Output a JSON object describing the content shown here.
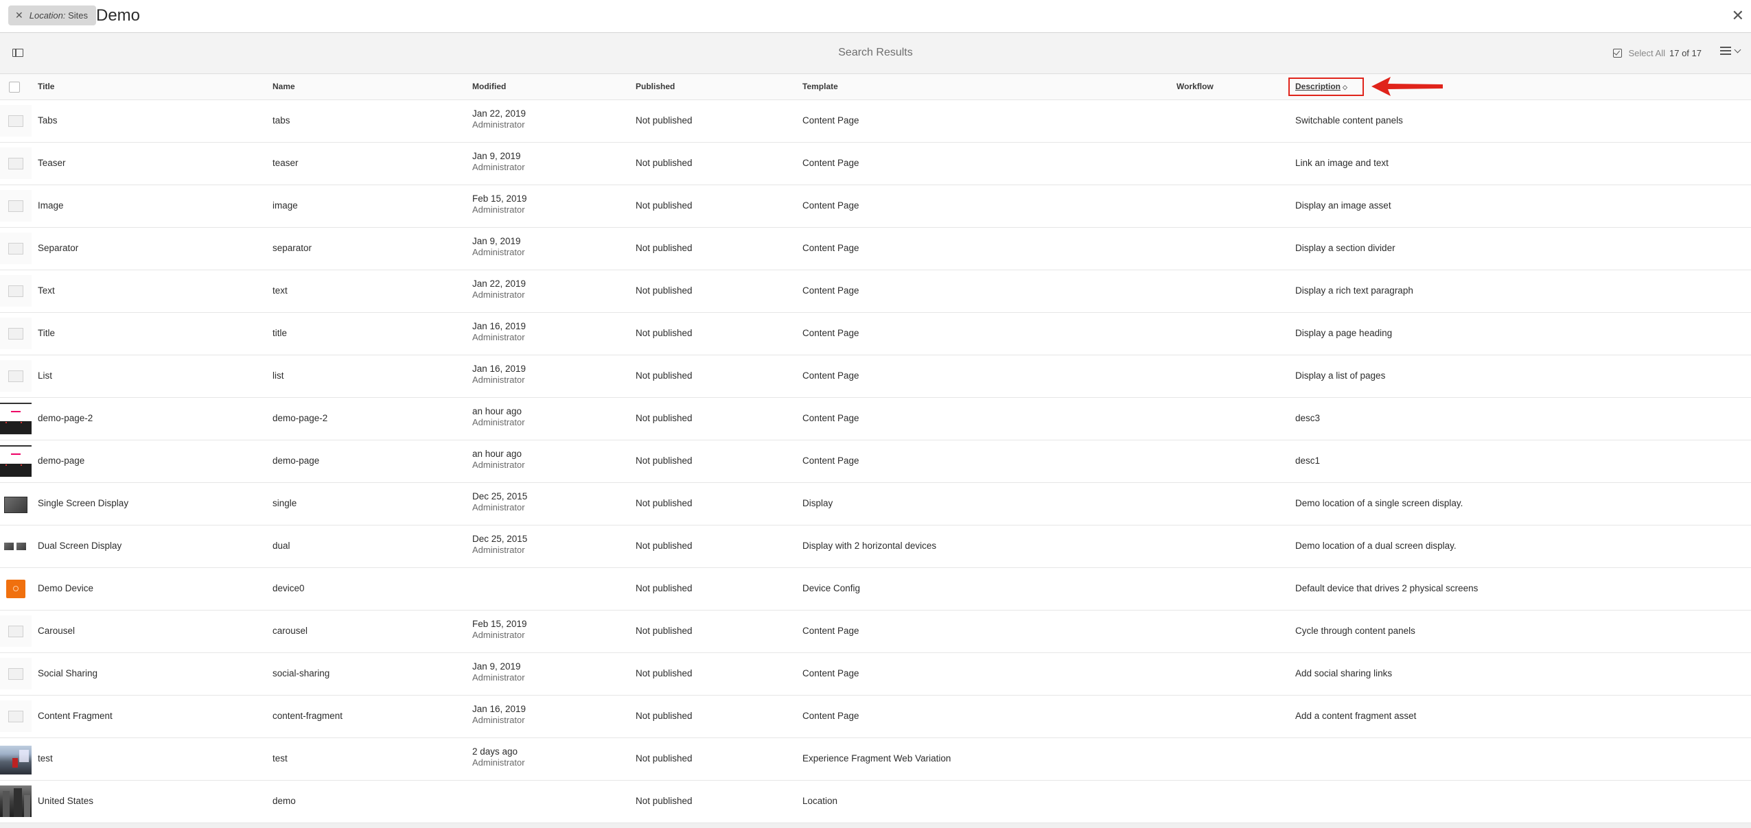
{
  "search": {
    "location_key": "Location:",
    "location_value": "Sites",
    "query": "Demo",
    "remove_icon": "close-icon",
    "close_icon": "close-icon"
  },
  "actionbar": {
    "title": "Search Results",
    "select_all": "Select All",
    "count": "17 of 17"
  },
  "columns": {
    "title": "Title",
    "name": "Name",
    "modified": "Modified",
    "published": "Published",
    "template": "Template",
    "workflow": "Workflow",
    "description": "Description"
  },
  "highlight_color": "#e0241b",
  "rows": [
    {
      "title": "Tabs",
      "name": "tabs",
      "modified": "Jan 22, 2019",
      "by": "Administrator",
      "published": "Not published",
      "template": "Content Page",
      "description": "Switchable content panels",
      "thumb": "component"
    },
    {
      "title": "Teaser",
      "name": "teaser",
      "modified": "Jan 9, 2019",
      "by": "Administrator",
      "published": "Not published",
      "template": "Content Page",
      "description": "Link an image and text",
      "thumb": "component"
    },
    {
      "title": "Image",
      "name": "image",
      "modified": "Feb 15, 2019",
      "by": "Administrator",
      "published": "Not published",
      "template": "Content Page",
      "description": "Display an image asset",
      "thumb": "component"
    },
    {
      "title": "Separator",
      "name": "separator",
      "modified": "Jan 9, 2019",
      "by": "Administrator",
      "published": "Not published",
      "template": "Content Page",
      "description": "Display a section divider",
      "thumb": "component"
    },
    {
      "title": "Text",
      "name": "text",
      "modified": "Jan 22, 2019",
      "by": "Administrator",
      "published": "Not published",
      "template": "Content Page",
      "description": "Display a rich text paragraph",
      "thumb": "component"
    },
    {
      "title": "Title",
      "name": "title",
      "modified": "Jan 16, 2019",
      "by": "Administrator",
      "published": "Not published",
      "template": "Content Page",
      "description": "Display a page heading",
      "thumb": "component"
    },
    {
      "title": "List",
      "name": "list",
      "modified": "Jan 16, 2019",
      "by": "Administrator",
      "published": "Not published",
      "template": "Content Page",
      "description": "Display a list of pages",
      "thumb": "component"
    },
    {
      "title": "demo-page-2",
      "name": "demo-page-2",
      "modified": "an hour ago",
      "by": "Administrator",
      "published": "Not published",
      "template": "Content Page",
      "description": "desc3",
      "thumb": "page"
    },
    {
      "title": "demo-page",
      "name": "demo-page",
      "modified": "an hour ago",
      "by": "Administrator",
      "published": "Not published",
      "template": "Content Page",
      "description": "desc1",
      "thumb": "page"
    },
    {
      "title": "Single Screen Display",
      "name": "single",
      "modified": "Dec 25, 2015",
      "by": "Administrator",
      "published": "Not published",
      "template": "Display",
      "description": "Demo location of a single screen display.",
      "thumb": "single"
    },
    {
      "title": "Dual Screen Display",
      "name": "dual",
      "modified": "Dec 25, 2015",
      "by": "Administrator",
      "published": "Not published",
      "template": "Display with 2 horizontal devices",
      "description": "Demo location of a dual screen display.",
      "thumb": "dual"
    },
    {
      "title": "Demo Device",
      "name": "device0",
      "modified": "",
      "by": "",
      "published": "Not published",
      "template": "Device Config",
      "description": "Default device that drives 2 physical screens",
      "thumb": "device"
    },
    {
      "title": "Carousel",
      "name": "carousel",
      "modified": "Feb 15, 2019",
      "by": "Administrator",
      "published": "Not published",
      "template": "Content Page",
      "description": "Cycle through content panels",
      "thumb": "component"
    },
    {
      "title": "Social Sharing",
      "name": "social-sharing",
      "modified": "Jan 9, 2019",
      "by": "Administrator",
      "published": "Not published",
      "template": "Content Page",
      "description": "Add social sharing links",
      "thumb": "component"
    },
    {
      "title": "Content Fragment",
      "name": "content-fragment",
      "modified": "Jan 16, 2019",
      "by": "Administrator",
      "published": "Not published",
      "template": "Content Page",
      "description": "Add a content fragment asset",
      "thumb": "component"
    },
    {
      "title": "test",
      "name": "test",
      "modified": "2 days ago",
      "by": "Administrator",
      "published": "Not published",
      "template": "Experience Fragment Web Variation",
      "description": "",
      "thumb": "photo"
    },
    {
      "title": "United States",
      "name": "demo",
      "modified": "",
      "by": "",
      "published": "Not published",
      "template": "Location",
      "description": "",
      "thumb": "city"
    }
  ]
}
